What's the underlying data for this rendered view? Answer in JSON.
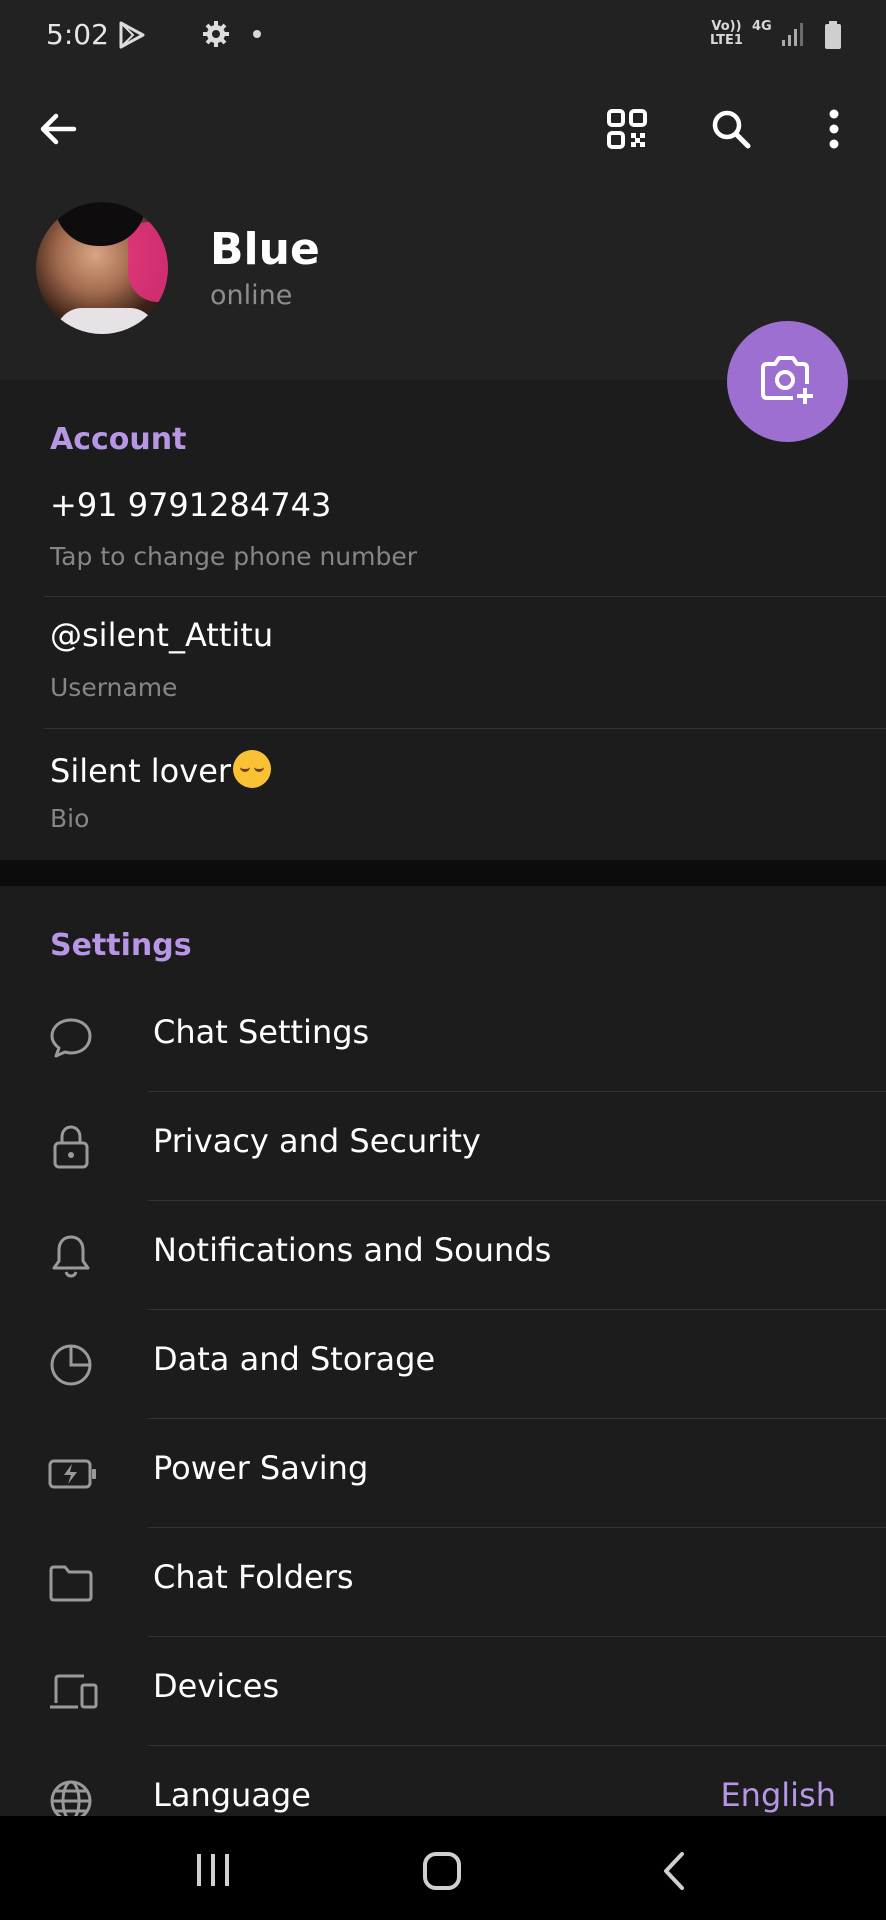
{
  "status_bar": {
    "time": "5:02",
    "network_line1": "Vo))",
    "network_line2": "LTE1",
    "network_type": "4G"
  },
  "header": {
    "icons": [
      "back-arrow-icon",
      "qr-code-icon",
      "search-icon",
      "more-vertical-icon"
    ]
  },
  "profile": {
    "name": "Blue",
    "status": "online"
  },
  "account": {
    "title": "Account",
    "phone": "+91 9791284743",
    "phone_label": "Tap to change phone number",
    "username": "@silent_Attitu",
    "username_label": "Username",
    "bio": "Silent lover",
    "bio_label": "Bio"
  },
  "settings": {
    "title": "Settings",
    "items": [
      {
        "label": "Chat Settings",
        "icon": "chat-bubble-icon"
      },
      {
        "label": "Privacy and Security",
        "icon": "lock-icon"
      },
      {
        "label": "Notifications and Sounds",
        "icon": "bell-icon"
      },
      {
        "label": "Data and Storage",
        "icon": "pie-chart-icon"
      },
      {
        "label": "Power Saving",
        "icon": "battery-charging-icon"
      },
      {
        "label": "Chat Folders",
        "icon": "folder-icon"
      },
      {
        "label": "Devices",
        "icon": "devices-icon"
      },
      {
        "label": "Language",
        "icon": "globe-icon",
        "value": "English"
      }
    ]
  },
  "colors": {
    "accent": "#b796e6",
    "fab": "#9c6fd1",
    "background": "#1c1c1c",
    "header": "#222222"
  }
}
